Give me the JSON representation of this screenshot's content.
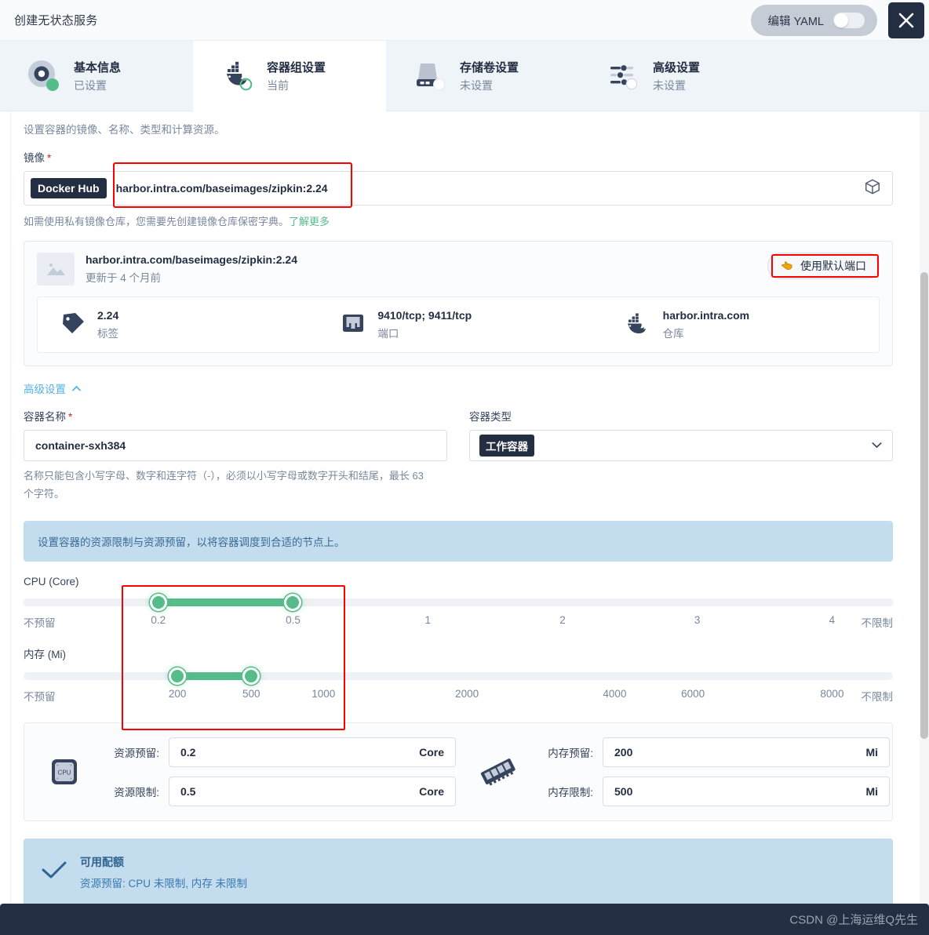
{
  "header": {
    "title": "创建无状态服务",
    "yaml_toggle_label": "编辑 YAML",
    "yaml_toggle_state": "off",
    "close_label": "关闭"
  },
  "steps": [
    {
      "title": "基本信息",
      "sub": "已设置",
      "icon": "basic-info-icon",
      "state": "done"
    },
    {
      "title": "容器组设置",
      "sub": "当前",
      "icon": "docker-whale-icon",
      "state": "current"
    },
    {
      "title": "存储卷设置",
      "sub": "未设置",
      "icon": "storage-volume-icon",
      "state": "todo"
    },
    {
      "title": "高级设置",
      "sub": "未设置",
      "icon": "sliders-icon",
      "state": "todo"
    }
  ],
  "form": {
    "section_desc": "设置容器的镜像、名称、类型和计算资源。",
    "image_label": "镜像",
    "image_required": "*",
    "registry_badge": "Docker Hub",
    "image_value": "harbor.intra.com/baseimages/zipkin:2.24",
    "image_hint_text": "如需使用私有镜像仓库，您需要先创建镜像仓库保密字典。",
    "image_hint_link": "了解更多"
  },
  "image_card": {
    "name": "harbor.intra.com/baseimages/zipkin:2.24",
    "updated": "更新于 4 个月前",
    "default_port_button": "使用默认端口",
    "meta": [
      {
        "icon": "tag-icon",
        "value": "2.24",
        "key": "标签"
      },
      {
        "icon": "port-icon",
        "value": "9410/tcp; 9411/tcp",
        "key": "端口"
      },
      {
        "icon": "docker-whale-icon",
        "value": "harbor.intra.com",
        "key": "仓库"
      }
    ]
  },
  "advanced": {
    "toggle_label": "高级设置",
    "container_name_label": "容器名称",
    "container_name_required": "*",
    "container_name_value": "container-sxh384",
    "container_name_helper": "名称只能包含小写字母、数字和连字符（-），必须以小写字母或数字开头和结尾，最长 63 个字符。",
    "container_type_label": "容器类型",
    "container_type_value": "工作容器"
  },
  "resources": {
    "banner": "设置容器的资源限制与资源预留，以将容器调度到合适的节点上。",
    "cpu": {
      "label": "CPU (Core)",
      "ticks": [
        "不预留",
        "0.2",
        "0.5",
        "1",
        "2",
        "3",
        "4",
        "不限制"
      ],
      "tick_positions": [
        0,
        15.5,
        31.0,
        46.5,
        62.0,
        77.5,
        93.0,
        100
      ],
      "range_start": "0.2",
      "range_end": "0.5"
    },
    "memory": {
      "label": "内存 (Mi)",
      "ticks": [
        "不预留",
        "200",
        "500",
        "1000",
        "2000",
        "4000",
        "6000",
        "8000",
        "不限制"
      ],
      "tick_positions": [
        0,
        17.7,
        26.2,
        34.5,
        51.0,
        68.0,
        77.0,
        93.0,
        100
      ],
      "range_start": "200",
      "range_end": "500"
    },
    "cpu_fields": {
      "icon": "cpu-chip-icon",
      "reserve_label": "资源预留:",
      "reserve_value": "0.2",
      "reserve_unit": "Core",
      "limit_label": "资源限制:",
      "limit_value": "0.5",
      "limit_unit": "Core"
    },
    "memory_fields": {
      "icon": "memory-stick-icon",
      "reserve_label": "内存预留:",
      "reserve_value": "200",
      "reserve_unit": "Mi",
      "limit_label": "内存限制:",
      "limit_value": "500",
      "limit_unit": "Mi"
    }
  },
  "quota": {
    "title": "可用配额",
    "sub": "资源预留: CPU 未限制, 内存 未限制"
  },
  "footer": {
    "watermark": "CSDN @上海运维Q先生"
  },
  "colors": {
    "accent_green": "#55bc8a",
    "accent_blue": "#55b0e4",
    "dark": "#242e42",
    "highlight_red": "#ff0000",
    "banner_blue": "#c3dcee"
  }
}
